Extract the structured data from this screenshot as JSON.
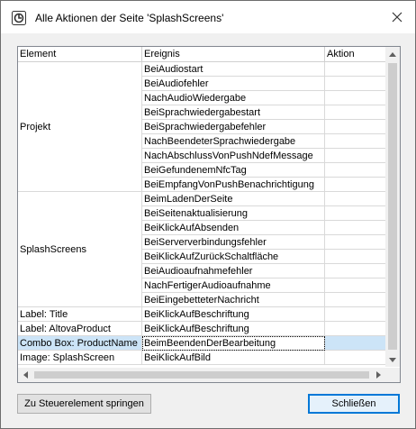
{
  "window": {
    "title": "Alle Aktionen der Seite 'SplashScreens'",
    "close_icon": "close-icon",
    "app_icon": "mobiletogether-app-icon"
  },
  "table": {
    "columns": [
      "Element",
      "Ereignis",
      "Aktion"
    ],
    "groups": [
      {
        "element": "Projekt",
        "events": [
          "BeiAudiostart",
          "BeiAudiofehler",
          "NachAudioWiedergabe",
          "BeiSprachwiedergabestart",
          "BeiSprachwiedergabefehler",
          "NachBeendeterSprachwiedergabe",
          "NachAbschlussVonPushNdefMessage",
          "BeiGefundenemNfcTag",
          "BeiEmpfangVonPushBenachrichtigung"
        ]
      },
      {
        "element": "SplashScreens",
        "events": [
          "BeimLadenDerSeite",
          "BeiSeitenaktualisierung",
          "BeiKlickAufAbsenden",
          "BeiSerververbindungsfehler",
          "BeiKlickAufZurückSchaltfläche",
          "BeiAudioaufnahmefehler",
          "NachFertigerAudioaufnahme",
          "BeiEingebetteterNachricht"
        ]
      },
      {
        "element": "Label: Title",
        "events": [
          "BeiKlickAufBeschriftung"
        ]
      },
      {
        "element": "Label: AltovaProduct",
        "events": [
          "BeiKlickAufBeschriftung"
        ]
      },
      {
        "element": "Combo Box: ProductName",
        "events": [
          "BeimBeendenDerBearbeitung"
        ],
        "selected": true
      },
      {
        "element": "Image: SplashScreen",
        "events": [
          "BeiKlickAufBild"
        ]
      }
    ]
  },
  "buttons": {
    "jump_label": "Zu Steuerelement springen",
    "close_label": "Schließen"
  },
  "colors": {
    "selection": "#cce4f7",
    "accent": "#0078d7"
  }
}
